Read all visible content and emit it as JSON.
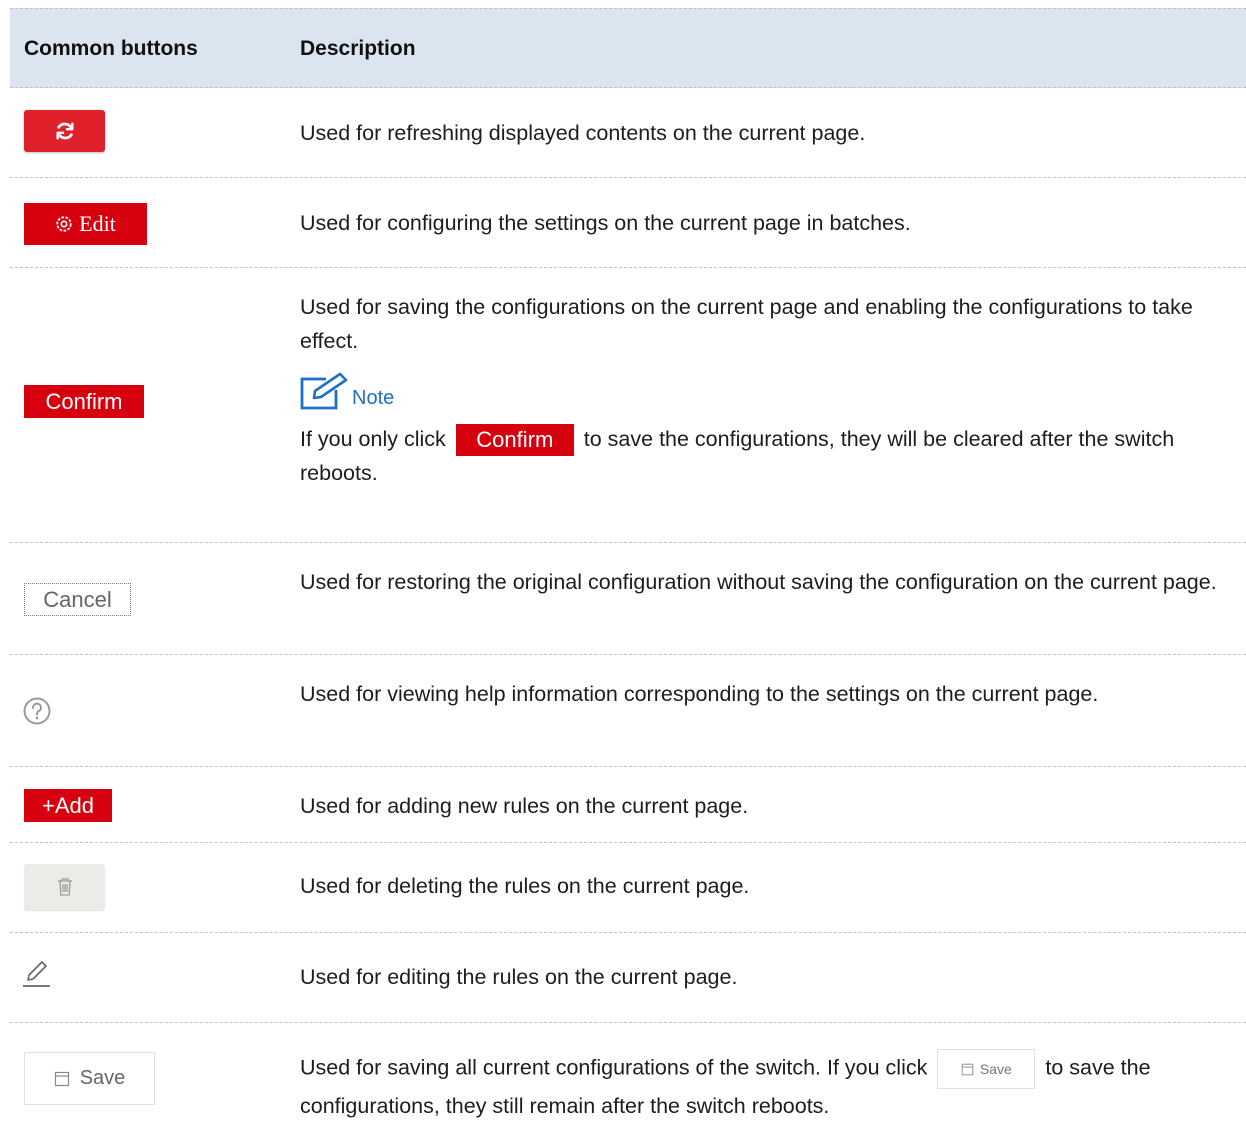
{
  "header": {
    "col1": "Common buttons",
    "col2": "Description"
  },
  "rows": {
    "refresh": {
      "icon": "refresh-icon",
      "desc": "Used for refreshing displayed contents on the current page."
    },
    "edit": {
      "label": "Edit",
      "icon": "gear-icon",
      "desc": "Used for configuring the settings on the current page in batches."
    },
    "confirm": {
      "label": "Confirm",
      "desc1": "Used for saving the configurations on the current page and enabling the configurations to take effect.",
      "note_label": "Note",
      "note_before": "If you only click",
      "note_button": "Confirm",
      "note_after": "to save the configurations, they will be cleared after the switch reboots."
    },
    "cancel": {
      "label": "Cancel",
      "desc": "Used for restoring the original configuration without saving the configuration on the current page."
    },
    "help": {
      "icon": "help-icon",
      "desc": "Used for viewing help information corresponding to the settings on the current page."
    },
    "add": {
      "label": "+Add",
      "desc": "Used for adding new rules on the current page."
    },
    "delete": {
      "icon": "trash-icon",
      "desc": "Used for deleting the rules on the current page."
    },
    "editrule": {
      "icon": "pencil-icon",
      "desc": "Used for editing the rules on the current page."
    },
    "save": {
      "label": "Save",
      "icon": "save-icon",
      "desc_before": "Used for saving all current configurations of the switch. If you click",
      "inline_label": "Save",
      "desc_after": "to save the configurations, they still remain after the switch reboots."
    }
  },
  "colors": {
    "accent_red": "#d7000f",
    "header_bg": "#dbe5f0",
    "note_blue": "#1f6fc8"
  }
}
